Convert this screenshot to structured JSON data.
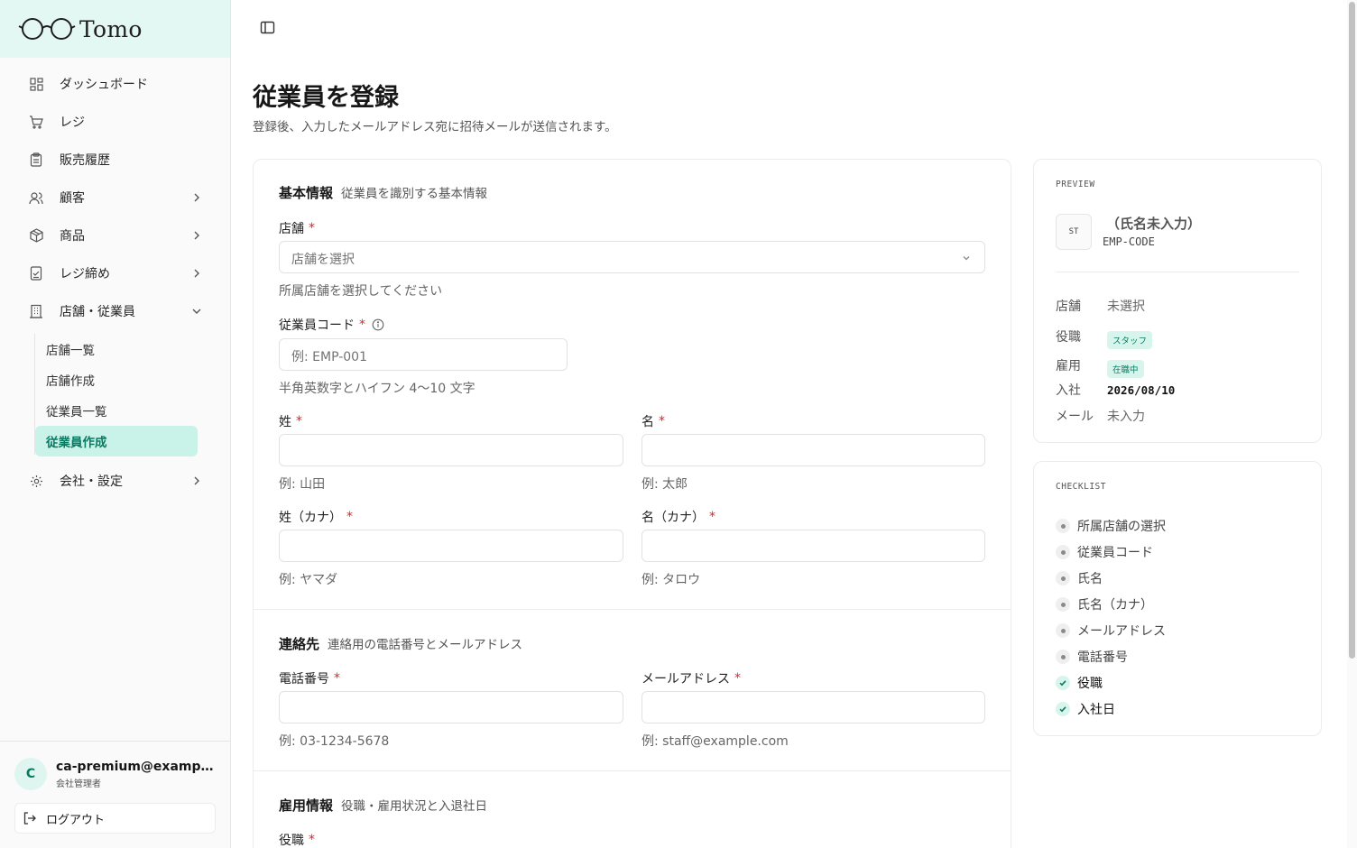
{
  "brand": {
    "name": "Tomo"
  },
  "sidebar": {
    "items": [
      {
        "label": "ダッシュボード"
      },
      {
        "label": "レジ"
      },
      {
        "label": "販売履歴"
      },
      {
        "label": "顧客"
      },
      {
        "label": "商品"
      },
      {
        "label": "レジ締め"
      },
      {
        "label": "店舗・従業員"
      },
      {
        "label": "会社・設定"
      }
    ],
    "subitems": [
      {
        "label": "店舗一覧"
      },
      {
        "label": "店舗作成"
      },
      {
        "label": "従業員一覧"
      },
      {
        "label": "従業員作成"
      }
    ]
  },
  "user": {
    "initial": "C",
    "email": "ca-premium@example.com",
    "role": "会社管理者"
  },
  "logout_label": "ログアウト",
  "page": {
    "title": "従業員を登録",
    "subtitle": "登録後、入力したメールアドレス宛に招待メールが送信されます。"
  },
  "form": {
    "basic": {
      "title": "基本情報",
      "desc": "従業員を識別する基本情報",
      "store_label": "店舗",
      "store_placeholder": "店舗を選択",
      "store_hint": "所属店舗を選択してください",
      "code_label": "従業員コード",
      "code_placeholder": "例: EMP-001",
      "code_hint": "半角英数字とハイフン 4〜10 文字",
      "last_label": "姓",
      "last_hint": "例: 山田",
      "first_label": "名",
      "first_hint": "例: 太郎",
      "last_kana_label": "姓（カナ）",
      "last_kana_hint": "例: ヤマダ",
      "first_kana_label": "名（カナ）",
      "first_kana_hint": "例: タロウ"
    },
    "contact": {
      "title": "連絡先",
      "desc": "連絡用の電話番号とメールアドレス",
      "phone_label": "電話番号",
      "phone_hint": "例: 03-1234-5678",
      "email_label": "メールアドレス",
      "email_hint": "例: staff@example.com"
    },
    "employment": {
      "title": "雇用情報",
      "desc": "役職・雇用状況と入退社日",
      "role_label": "役職"
    }
  },
  "preview": {
    "label": "PREVIEW",
    "avatar": "ST",
    "name": "（氏名未入力）",
    "code": "EMP-CODE",
    "rows": {
      "store_key": "店舗",
      "store_val": "未選択",
      "role_key": "役職",
      "role_val": "スタッフ",
      "employment_key": "雇用",
      "employment_val": "在職中",
      "joined_key": "入社",
      "joined_val": "2026/08/10",
      "mail_key": "メール",
      "mail_val": "未入力"
    }
  },
  "checklist": {
    "label": "CHECKLIST",
    "items": [
      {
        "label": "所属店舗の選択",
        "done": false
      },
      {
        "label": "従業員コード",
        "done": false
      },
      {
        "label": "氏名",
        "done": false
      },
      {
        "label": "氏名（カナ）",
        "done": false
      },
      {
        "label": "メールアドレス",
        "done": false
      },
      {
        "label": "電話番号",
        "done": false
      },
      {
        "label": "役職",
        "done": true
      },
      {
        "label": "入社日",
        "done": true
      }
    ]
  },
  "colors": {
    "accent": "#0a7a62",
    "accent_bg": "#c9f2e9",
    "brand_bg": "#e3f8f3",
    "required": "#dc2626"
  }
}
